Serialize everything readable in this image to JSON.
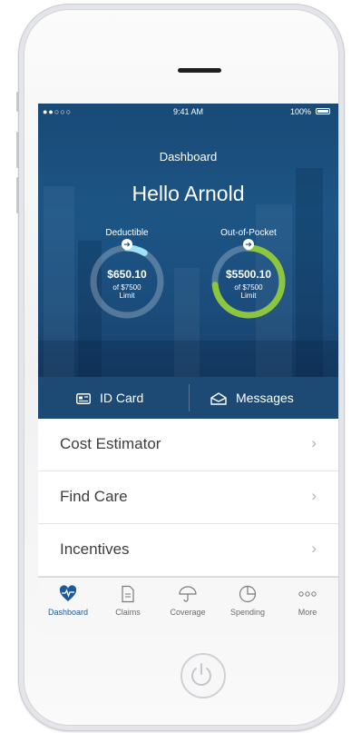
{
  "status_bar": {
    "signal": "●●○○○",
    "time": "9:41 AM",
    "battery_percent": "100%"
  },
  "header": {
    "title": "Dashboard",
    "greeting": "Hello Arnold"
  },
  "deductible": {
    "label": "Deductible",
    "amount": "$650.10",
    "limit_line1": "of $7500",
    "limit_line2": "Limit",
    "progress": 0.087,
    "ring_color": "#9fe0f2",
    "arrow": "➔"
  },
  "out_of_pocket": {
    "label": "Out-of-Pocket",
    "amount": "$5500.10",
    "limit_line1": "of $7500",
    "limit_line2": "Limit",
    "progress": 0.733,
    "ring_color": "#8cc63f",
    "arrow": "➔"
  },
  "quick_actions": {
    "id_card": {
      "label": "ID Card",
      "icon": "id-card-icon"
    },
    "messages": {
      "label": "Messages",
      "icon": "envelope-icon"
    }
  },
  "menu": [
    {
      "label": "Cost Estimator",
      "chevron": "›"
    },
    {
      "label": "Find Care",
      "chevron": "›"
    },
    {
      "label": "Incentives",
      "chevron": "›"
    }
  ],
  "tabs": [
    {
      "label": "Dashboard",
      "icon": "heart-pulse-icon",
      "active": true
    },
    {
      "label": "Claims",
      "icon": "document-icon",
      "active": false
    },
    {
      "label": "Coverage",
      "icon": "umbrella-icon",
      "active": false
    },
    {
      "label": "Spending",
      "icon": "pie-chart-icon",
      "active": false
    },
    {
      "label": "More",
      "icon": "more-dots-icon",
      "active": false
    }
  ],
  "colors": {
    "brand_blue": "#1c5585",
    "active_tab": "#1c5a9a",
    "deductible_ring": "#9fe0f2",
    "oop_ring": "#8cc63f"
  }
}
